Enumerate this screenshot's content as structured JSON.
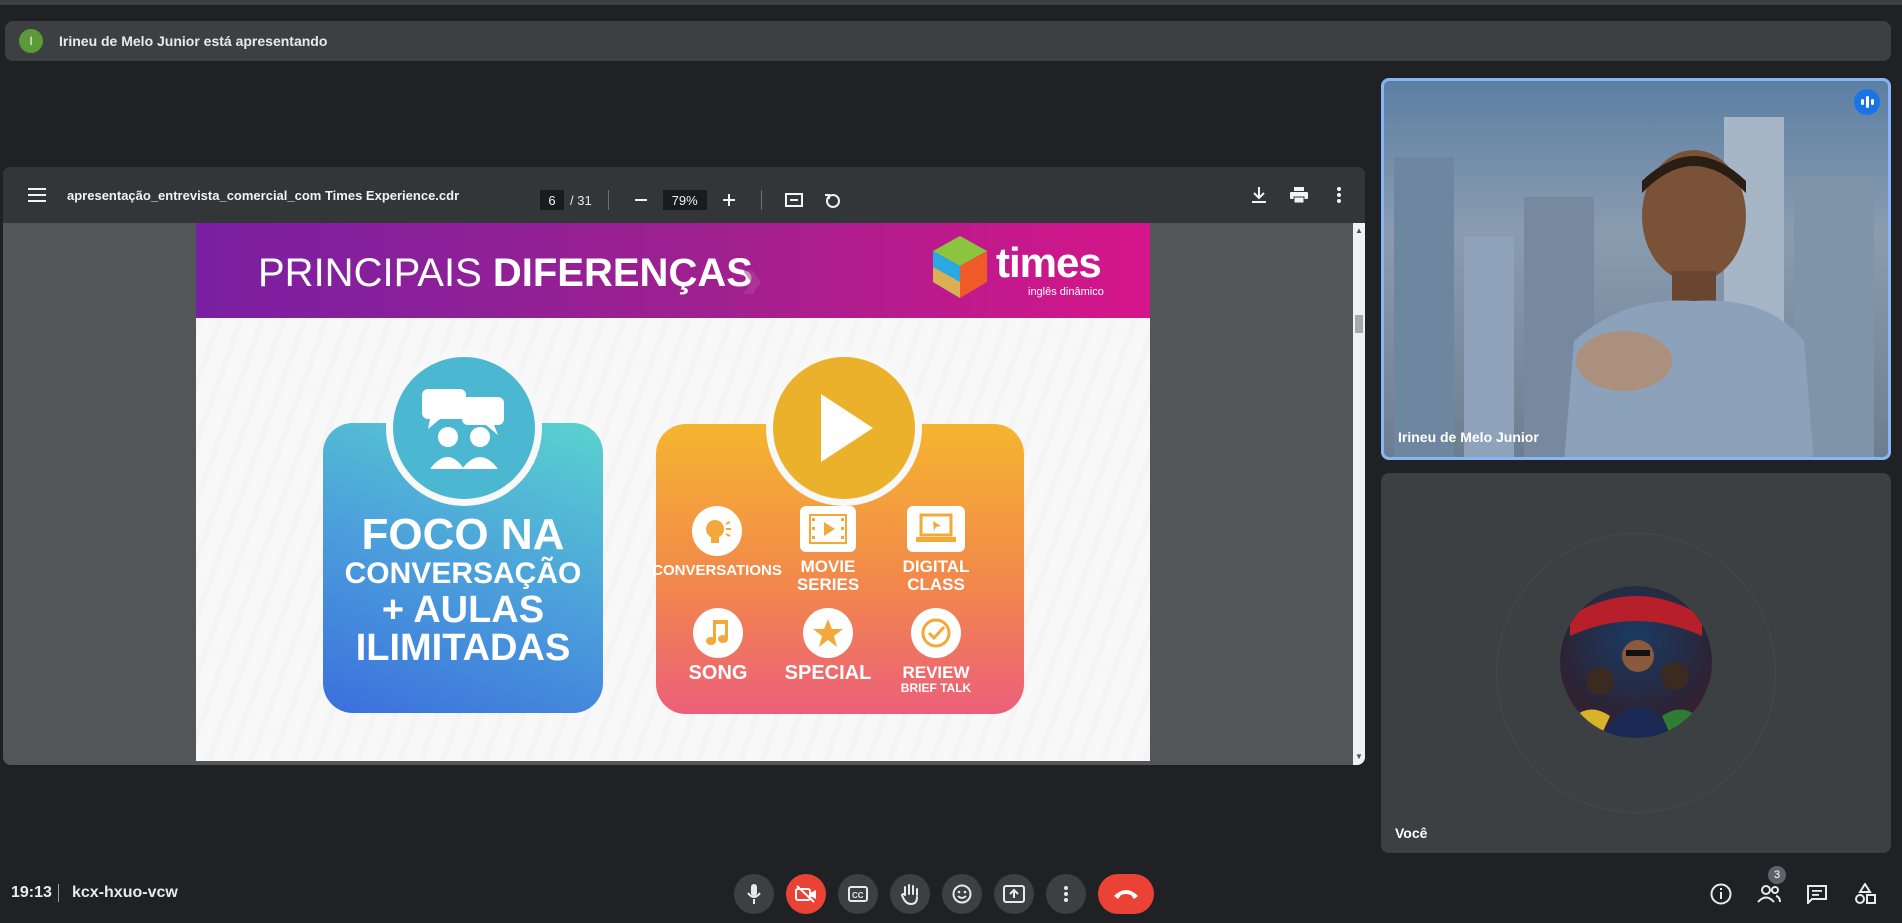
{
  "banner": {
    "avatar_letter": "I",
    "text": "Irineu de Melo Junior está apresentando"
  },
  "pdf": {
    "filename": "apresentação_entrevista_comercial_com Times Experience.cdr",
    "page_current": "6",
    "page_total": "/ 31",
    "zoom": "79%",
    "icons": [
      "menu-icon",
      "zoom-out-icon",
      "zoom-in-icon",
      "fit-page-icon",
      "rotate-icon",
      "download-icon",
      "print-icon",
      "more-vert-icon"
    ]
  },
  "slide": {
    "title_light": "PRINCIPAIS",
    "title_bold": "DIFERENÇAS",
    "brand_name": "times",
    "brand_tagline": "inglês dinâmico",
    "left_card": {
      "line1": "FOCO NA",
      "line2": "CONVERSAÇÃO",
      "line3": "+ AULAS",
      "line4": "ILIMITADAS"
    },
    "features": [
      {
        "label": "CONVERSATIONS",
        "sub": ""
      },
      {
        "label": "MOVIE",
        "sub": "SERIES"
      },
      {
        "label": "DIGITAL",
        "sub": "CLASS"
      },
      {
        "label": "SONG",
        "sub": ""
      },
      {
        "label": "SPECIAL",
        "sub": ""
      },
      {
        "label": "REVIEW",
        "sub": "BRIEF TALK"
      }
    ],
    "colors": {
      "header_start": "#7a1fa2",
      "header_end": "#d6158a",
      "left_card": "#4a9bdc",
      "right_card": "#f2884c"
    }
  },
  "participants": {
    "main_name": "Irineu de Melo Junior",
    "self_name": "Você"
  },
  "bottom_bar": {
    "time": "19:13",
    "meeting_code": "kcx-hxuo-vcw",
    "people_count": "3",
    "controls": [
      "mic-icon",
      "camera-off-icon",
      "captions-icon",
      "raise-hand-icon",
      "emoji-icon",
      "present-icon",
      "more-vert-icon",
      "end-call-icon"
    ],
    "side_controls": [
      "info-icon",
      "people-icon",
      "chat-icon",
      "activities-icon"
    ]
  },
  "accent": {
    "blue": "#8ab4f8",
    "red": "#ea4335",
    "green": "#5b9a37"
  }
}
